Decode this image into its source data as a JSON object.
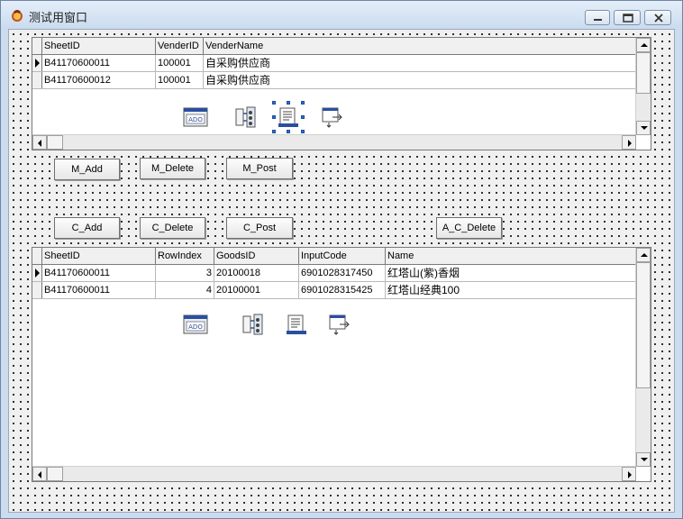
{
  "window": {
    "title": "测试用窗口",
    "controls": [
      "minimize-icon",
      "restore-icon",
      "close-icon"
    ]
  },
  "master": {
    "columns": [
      {
        "label": "SheetID"
      },
      {
        "label": "VenderID"
      },
      {
        "label": "VenderName"
      }
    ],
    "rows": [
      [
        "B41170600011",
        "100001",
        "自采购供应商"
      ],
      [
        "B41170600012",
        "100001",
        "自采购供应商"
      ]
    ],
    "buttons": {
      "add": "M_Add",
      "delete": "M_Delete",
      "post": "M_Post"
    }
  },
  "detail": {
    "columns": [
      {
        "label": "SheetID"
      },
      {
        "label": "RowIndex"
      },
      {
        "label": "GoodsID"
      },
      {
        "label": "InputCode"
      },
      {
        "label": "Name"
      }
    ],
    "rows": [
      [
        "B41170600011",
        "3",
        "20100018",
        "6901028317450",
        "红塔山(紫)香烟"
      ],
      [
        "B41170600011",
        "4",
        "20100001",
        "6901028315425",
        "红塔山经典100"
      ]
    ],
    "buttons": {
      "add": "C_Add",
      "delete": "C_Delete",
      "post": "C_Post",
      "all_delete": "A_C_Delete"
    }
  },
  "components": [
    "ado-connection-icon",
    "data-source-icon",
    "query-icon",
    "update-sql-icon"
  ],
  "colors": {
    "title_bg": "#cbdcef",
    "selection": "#2f6fcf"
  }
}
